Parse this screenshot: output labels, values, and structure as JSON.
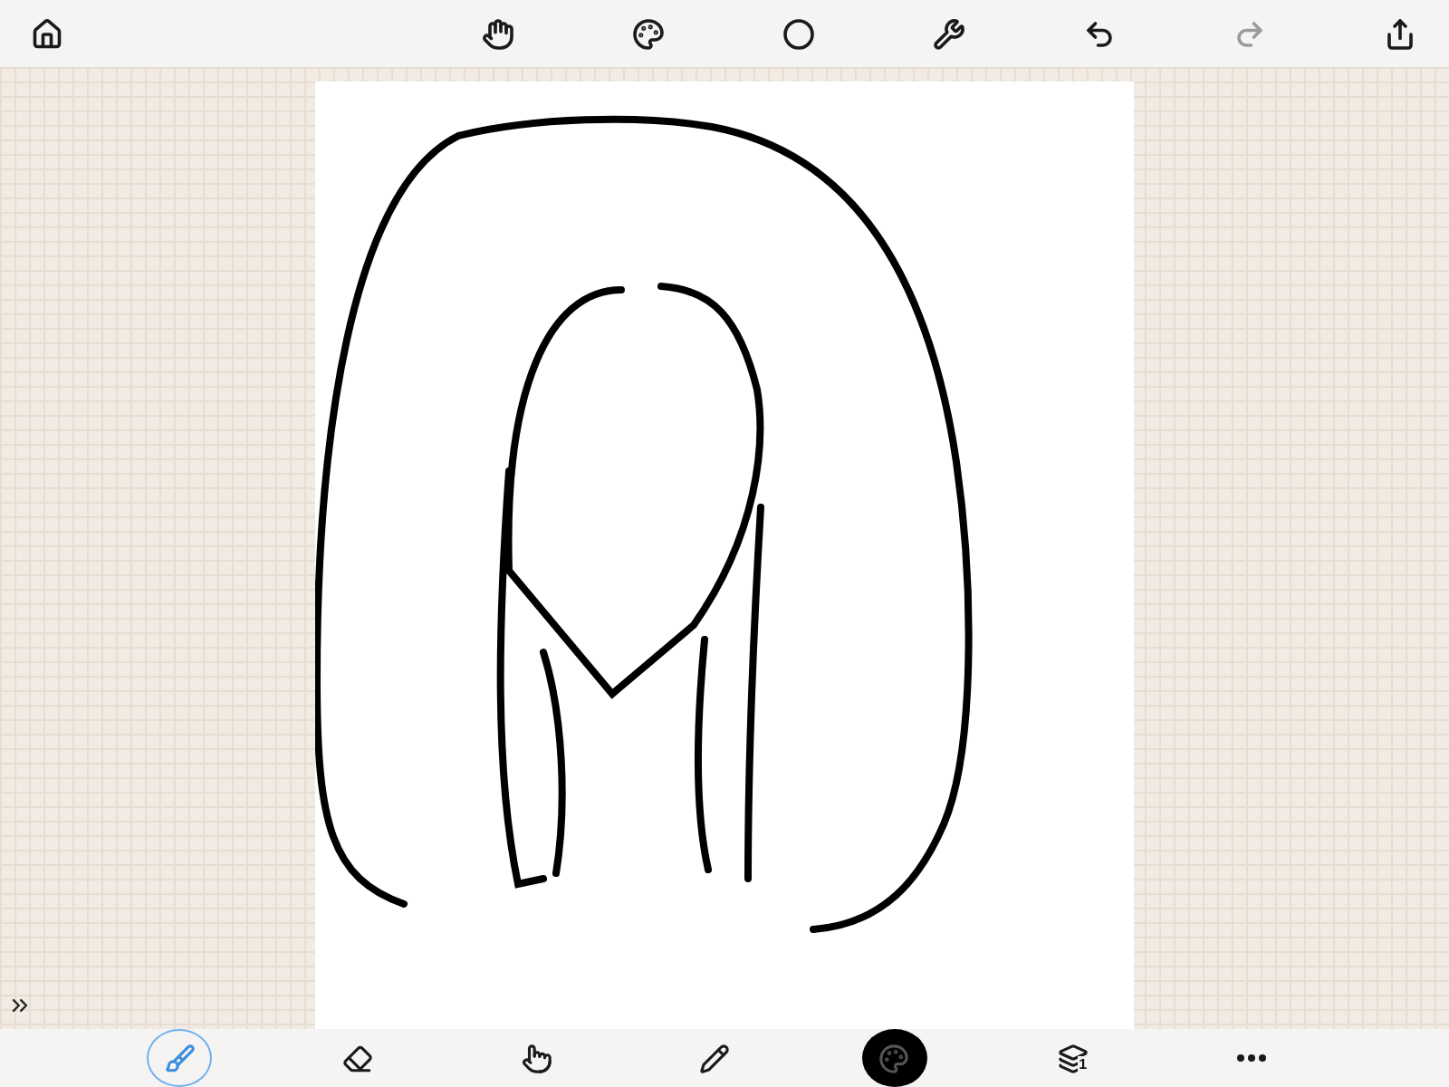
{
  "top_toolbar": [
    {
      "kind": "home",
      "disabled": false
    },
    {
      "kind": "hand",
      "disabled": false
    },
    {
      "kind": "palette",
      "disabled": false
    },
    {
      "kind": "circle",
      "disabled": false
    },
    {
      "kind": "wrench",
      "disabled": false
    },
    {
      "kind": "undo",
      "disabled": false
    },
    {
      "kind": "redo",
      "disabled": true
    },
    {
      "kind": "share",
      "disabled": false
    }
  ],
  "bottom_toolbar": [
    {
      "kind": "brush",
      "selected": true
    },
    {
      "kind": "eraser",
      "selected": false
    },
    {
      "kind": "pointer",
      "selected": false
    },
    {
      "kind": "pencil",
      "selected": false
    },
    {
      "kind": "color",
      "selected": false
    },
    {
      "kind": "layers",
      "selected": false,
      "count": "1"
    },
    {
      "kind": "more",
      "selected": false
    }
  ]
}
